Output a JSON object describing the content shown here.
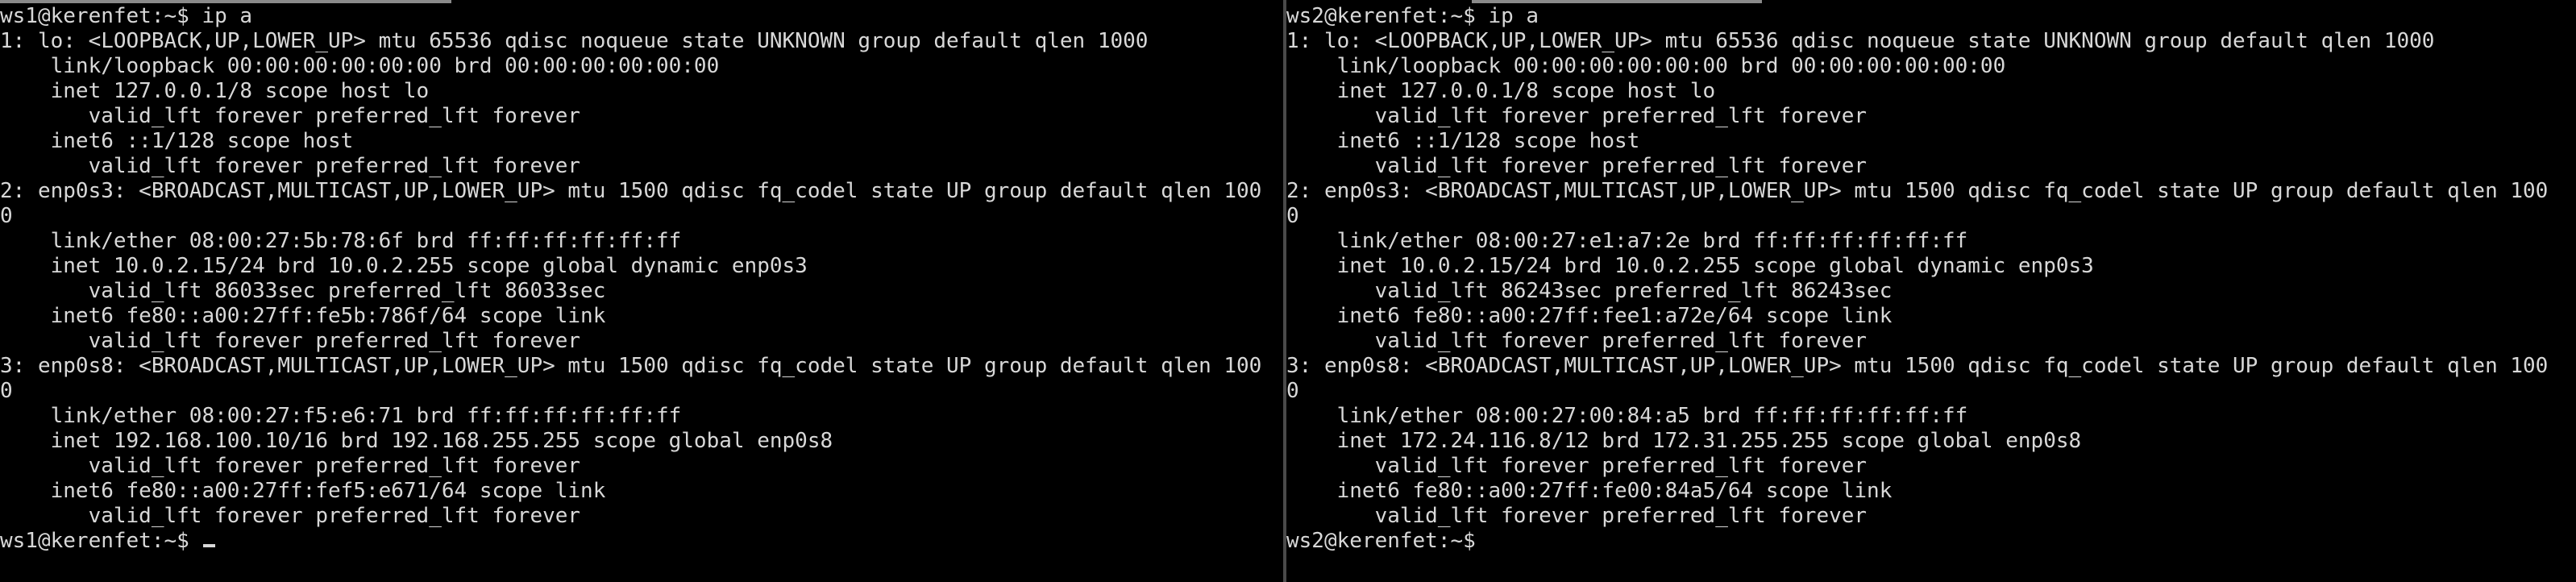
{
  "panes": [
    {
      "lines": [
        "ws1@kerenfet:~$ ip a",
        "1: lo: <LOOPBACK,UP,LOWER_UP> mtu 65536 qdisc noqueue state UNKNOWN group default qlen 1000",
        "    link/loopback 00:00:00:00:00:00 brd 00:00:00:00:00:00",
        "    inet 127.0.0.1/8 scope host lo",
        "       valid_lft forever preferred_lft forever",
        "    inet6 ::1/128 scope host",
        "       valid_lft forever preferred_lft forever",
        "2: enp0s3: <BROADCAST,MULTICAST,UP,LOWER_UP> mtu 1500 qdisc fq_codel state UP group default qlen 100",
        "0",
        "    link/ether 08:00:27:5b:78:6f brd ff:ff:ff:ff:ff:ff",
        "    inet 10.0.2.15/24 brd 10.0.2.255 scope global dynamic enp0s3",
        "       valid_lft 86033sec preferred_lft 86033sec",
        "    inet6 fe80::a00:27ff:fe5b:786f/64 scope link",
        "       valid_lft forever preferred_lft forever",
        "3: enp0s8: <BROADCAST,MULTICAST,UP,LOWER_UP> mtu 1500 qdisc fq_codel state UP group default qlen 100",
        "0",
        "    link/ether 08:00:27:f5:e6:71 brd ff:ff:ff:ff:ff:ff",
        "    inet 192.168.100.10/16 brd 192.168.255.255 scope global enp0s8",
        "       valid_lft forever preferred_lft forever",
        "    inet6 fe80::a00:27ff:fef5:e671/64 scope link",
        "       valid_lft forever preferred_lft forever"
      ],
      "prompt": "ws1@kerenfet:~$ "
    },
    {
      "lines": [
        "ws2@kerenfet:~$ ip a",
        "1: lo: <LOOPBACK,UP,LOWER_UP> mtu 65536 qdisc noqueue state UNKNOWN group default qlen 1000",
        "    link/loopback 00:00:00:00:00:00 brd 00:00:00:00:00:00",
        "    inet 127.0.0.1/8 scope host lo",
        "       valid_lft forever preferred_lft forever",
        "    inet6 ::1/128 scope host",
        "       valid_lft forever preferred_lft forever",
        "2: enp0s3: <BROADCAST,MULTICAST,UP,LOWER_UP> mtu 1500 qdisc fq_codel state UP group default qlen 100",
        "0",
        "    link/ether 08:00:27:e1:a7:2e brd ff:ff:ff:ff:ff:ff",
        "    inet 10.0.2.15/24 brd 10.0.2.255 scope global dynamic enp0s3",
        "       valid_lft 86243sec preferred_lft 86243sec",
        "    inet6 fe80::a00:27ff:fee1:a72e/64 scope link",
        "       valid_lft forever preferred_lft forever",
        "3: enp0s8: <BROADCAST,MULTICAST,UP,LOWER_UP> mtu 1500 qdisc fq_codel state UP group default qlen 100",
        "0",
        "    link/ether 08:00:27:00:84:a5 brd ff:ff:ff:ff:ff:ff",
        "    inet 172.24.116.8/12 brd 172.31.255.255 scope global enp0s8",
        "       valid_lft forever preferred_lft forever",
        "    inet6 fe80::a00:27ff:fe00:84a5/64 scope link",
        "       valid_lft forever preferred_lft forever"
      ],
      "prompt": "ws2@kerenfet:~$"
    }
  ],
  "colors": {
    "background": "#000000",
    "foreground": "#d8d8d8",
    "divider": "#4a4a4a"
  }
}
